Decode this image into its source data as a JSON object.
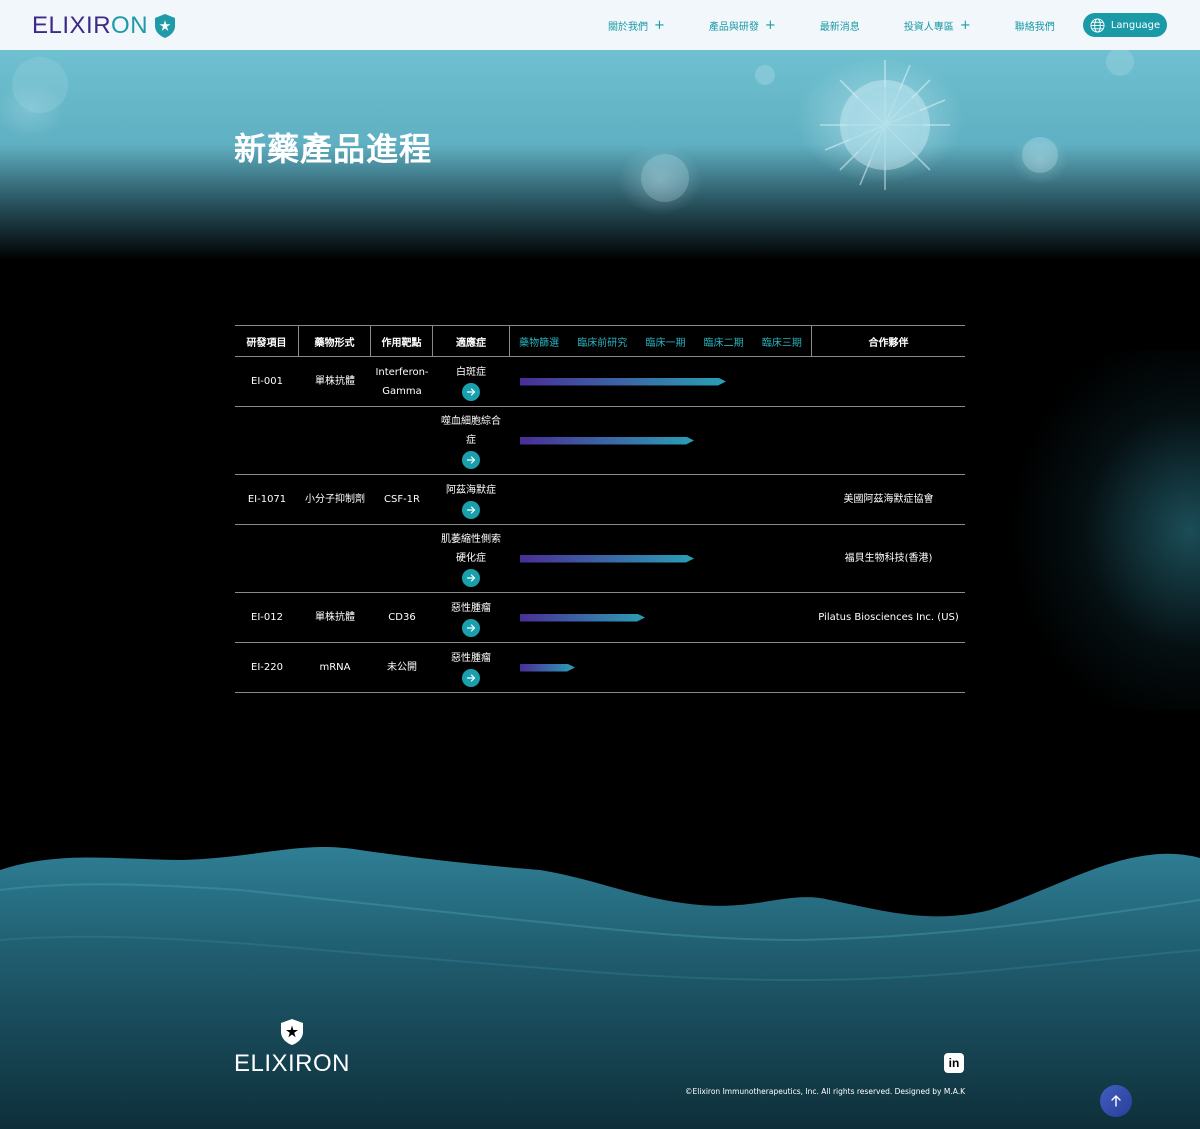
{
  "brand": {
    "logo_text_main": "ELIXIR",
    "logo_text_accent": "ON",
    "footer_logo_text": "ELIXIRON",
    "primary_color": "#3d2a86",
    "accent_color": "#1a9aa6"
  },
  "nav": {
    "items": [
      {
        "label": "關於我們",
        "has_submenu": true
      },
      {
        "label": "產品與研發",
        "has_submenu": true
      },
      {
        "label": "最新消息",
        "has_submenu": false
      },
      {
        "label": "投資人專區",
        "has_submenu": true
      },
      {
        "label": "聯絡我們",
        "has_submenu": false
      }
    ],
    "plus_symbol": "+",
    "language_label": "Language",
    "language_icon": "globe-icon"
  },
  "hero": {
    "title": "新藥產品進程"
  },
  "pipeline": {
    "headers": {
      "project": "研發項目",
      "form": "藥物形式",
      "target": "作用靶點",
      "indication": "適應症",
      "partner": "合作夥伴"
    },
    "phases": [
      "藥物篩選",
      "臨床前研究",
      "臨床一期",
      "臨床二期",
      "臨床三期"
    ],
    "rows": [
      {
        "project": "EI-001",
        "form": "單株抗體",
        "target": "Interferon-Gamma",
        "indication": "白斑症",
        "progress": 0.71,
        "partner": "",
        "height": 50
      },
      {
        "project": "",
        "form": "",
        "target": "",
        "indication": "噬血細胞綜合症",
        "progress": 0.6,
        "partner": "",
        "height": 68
      },
      {
        "project": "EI-1071",
        "form": "小分子抑制劑",
        "target": "CSF-1R",
        "indication": "阿茲海默症",
        "progress": 0,
        "partner": "美國阿茲海默症協會",
        "height": 50
      },
      {
        "project": "",
        "form": "",
        "target": "",
        "indication": "肌萎縮性側索硬化症",
        "progress": 0.6,
        "partner": "福貝生物科技(香港)",
        "height": 68
      },
      {
        "project": "EI-012",
        "form": "單株抗體",
        "target": "CD36",
        "indication": "惡性腫瘤",
        "progress": 0.43,
        "partner": "Pilatus Biosciences Inc. (US)",
        "height": 50
      },
      {
        "project": "EI-220",
        "form": "mRNA",
        "target": "未公開",
        "indication": "惡性腫瘤",
        "progress": 0.19,
        "partner": "",
        "height": 50
      }
    ],
    "arrow_icon": "arrow-right-icon"
  },
  "footer": {
    "copyright": "©Elixiron Immunotherapeutics, Inc. All rights reserved. Designed by M.A.K",
    "linkedin_label": "in",
    "to_top_icon": "arrow-up-icon"
  }
}
